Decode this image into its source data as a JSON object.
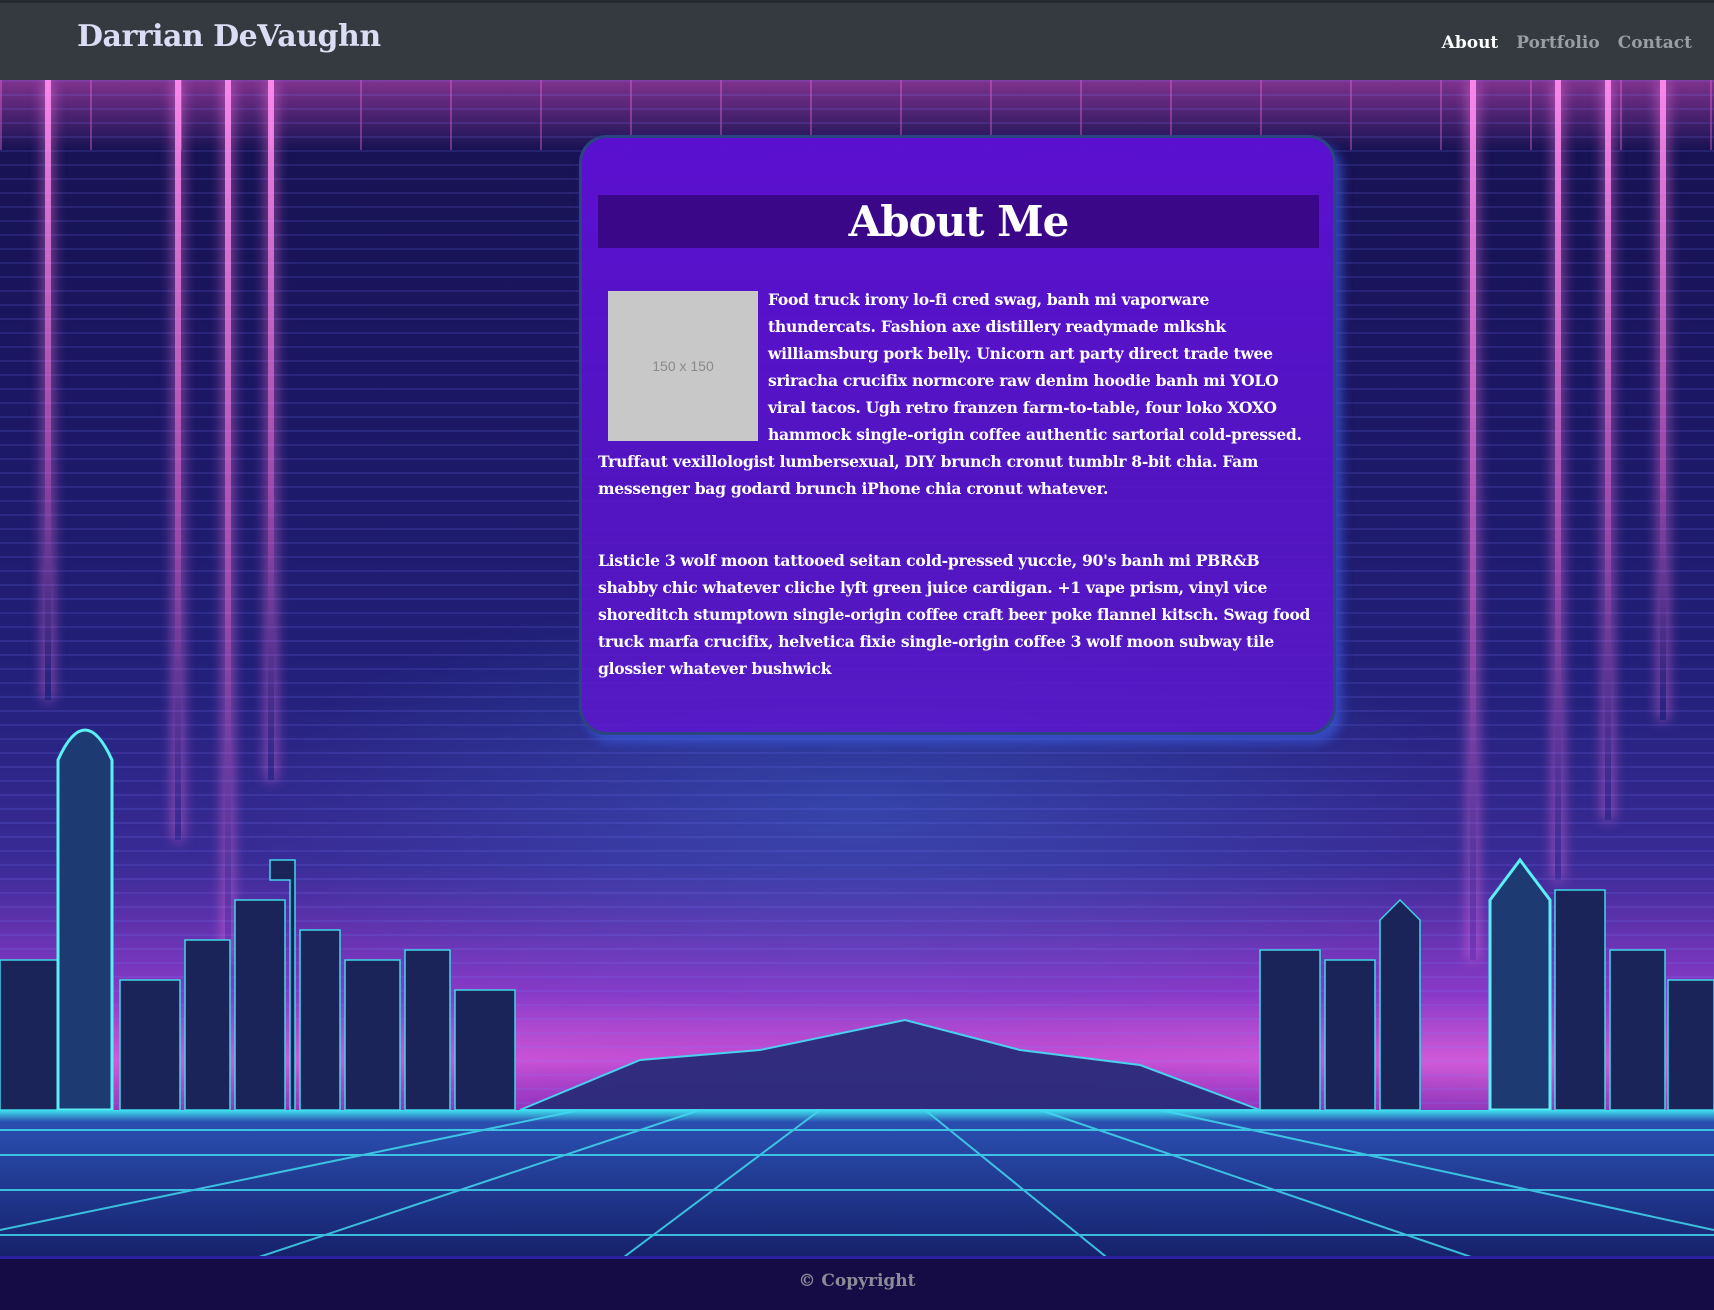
{
  "navbar": {
    "brand": "Darrian DeVaughn",
    "links": [
      {
        "label": "About",
        "active": true
      },
      {
        "label": "Portfolio",
        "active": false
      },
      {
        "label": "Contact",
        "active": false
      }
    ]
  },
  "about": {
    "title": "About Me",
    "image_placeholder": "150 x 150",
    "paragraph_1": "Food truck irony lo-fi cred swag, banh mi vaporware thundercats. Fashion axe distillery readymade mlkshk williamsburg pork belly. Unicorn art party direct trade twee sriracha crucifix normcore raw denim hoodie banh mi YOLO viral tacos. Ugh retro franzen farm-to-table, four loko XOXO hammock single-origin coffee authentic sartorial cold-pressed. Truffaut vexillologist lumbersexual, DIY brunch cronut tumblr 8-bit chia. Fam messenger bag godard brunch iPhone chia cronut whatever.",
    "paragraph_2": "Listicle 3 wolf moon tattooed seitan cold-pressed yuccie, 90's banh mi PBR&B shabby chic whatever cliche lyft green juice cardigan. +1 vape prism, vinyl vice shoreditch stumptown single-origin coffee craft beer poke flannel kitsch. Swag food truck marfa crucifix, helvetica fixie single-origin coffee 3 wolf moon subway tile glossier whatever bushwick"
  },
  "footer": {
    "copyright": "© Copyright"
  },
  "colors": {
    "navbar_bg": "#343a40",
    "card_bg": "#5c10d2",
    "title_bar_bg": "#3a0788",
    "footer_bg": "#150c45",
    "accent_neon_pink": "#ff6ee6",
    "accent_neon_cyan": "#3fe3f0"
  }
}
